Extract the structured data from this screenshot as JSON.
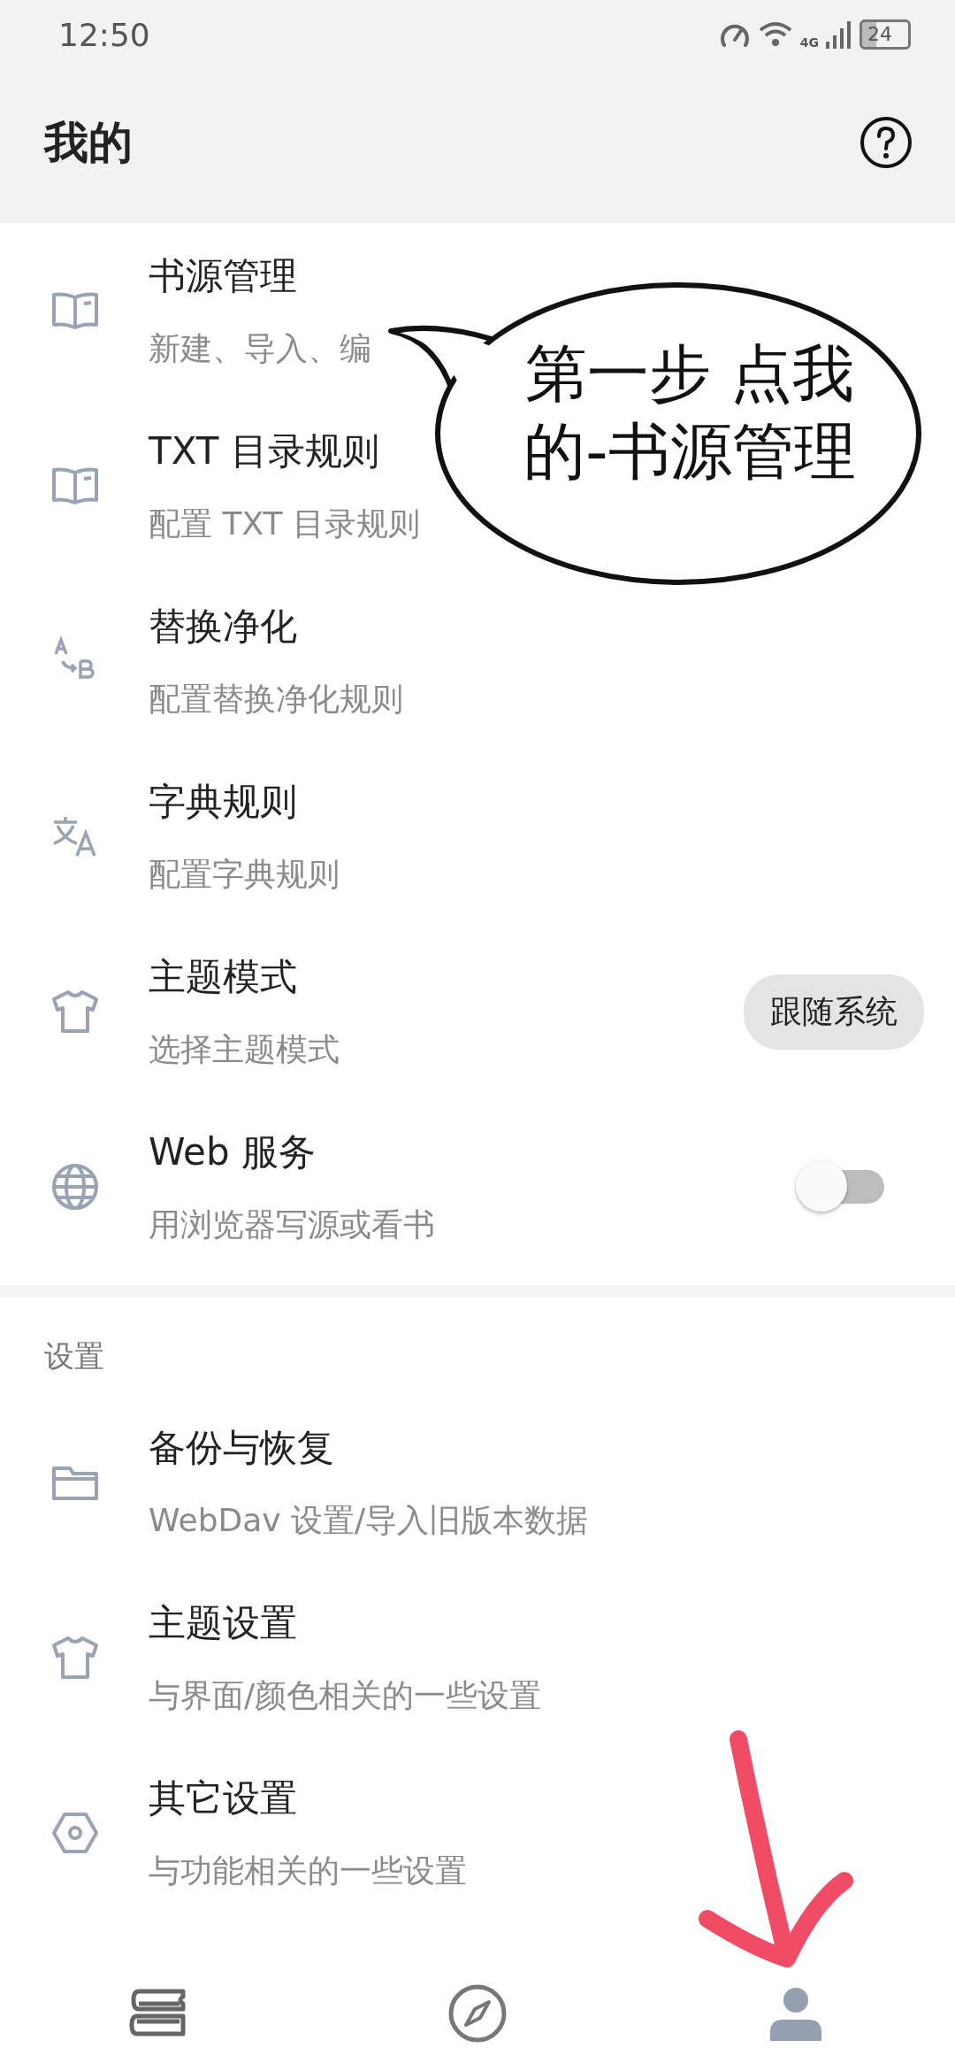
{
  "status_bar": {
    "time": "12:50",
    "network": "4G",
    "battery": "24"
  },
  "header": {
    "title": "我的"
  },
  "sections": [
    {
      "items": [
        {
          "kind": "plain",
          "title": "书源管理",
          "subtitle": "新建、导入、编"
        },
        {
          "kind": "plain",
          "title": "TXT 目录规则",
          "subtitle": "配置 TXT 目录规则"
        },
        {
          "kind": "plain",
          "title": "替换净化",
          "subtitle": "配置替换净化规则"
        },
        {
          "kind": "plain",
          "title": "字典规则",
          "subtitle": "配置字典规则"
        },
        {
          "kind": "chip",
          "title": "主题模式",
          "subtitle": "选择主题模式",
          "value": "跟随系统"
        },
        {
          "kind": "toggle",
          "title": "Web 服务",
          "subtitle": "用浏览器写源或看书",
          "on": false
        }
      ]
    },
    {
      "title": "设置",
      "items": [
        {
          "kind": "plain",
          "title": "备份与恢复",
          "subtitle": "WebDav 设置/导入旧版本数据"
        },
        {
          "kind": "plain",
          "title": "主题设置",
          "subtitle": "与界面/颜色相关的一些设置"
        },
        {
          "kind": "plain",
          "title": "其它设置",
          "subtitle": "与功能相关的一些设置"
        }
      ]
    }
  ],
  "bottom_nav": [
    {
      "selected": false
    },
    {
      "selected": false
    },
    {
      "selected": true
    }
  ],
  "annotation": {
    "bubble_lines": [
      "第一步 点我",
      "的-书源管理"
    ]
  }
}
